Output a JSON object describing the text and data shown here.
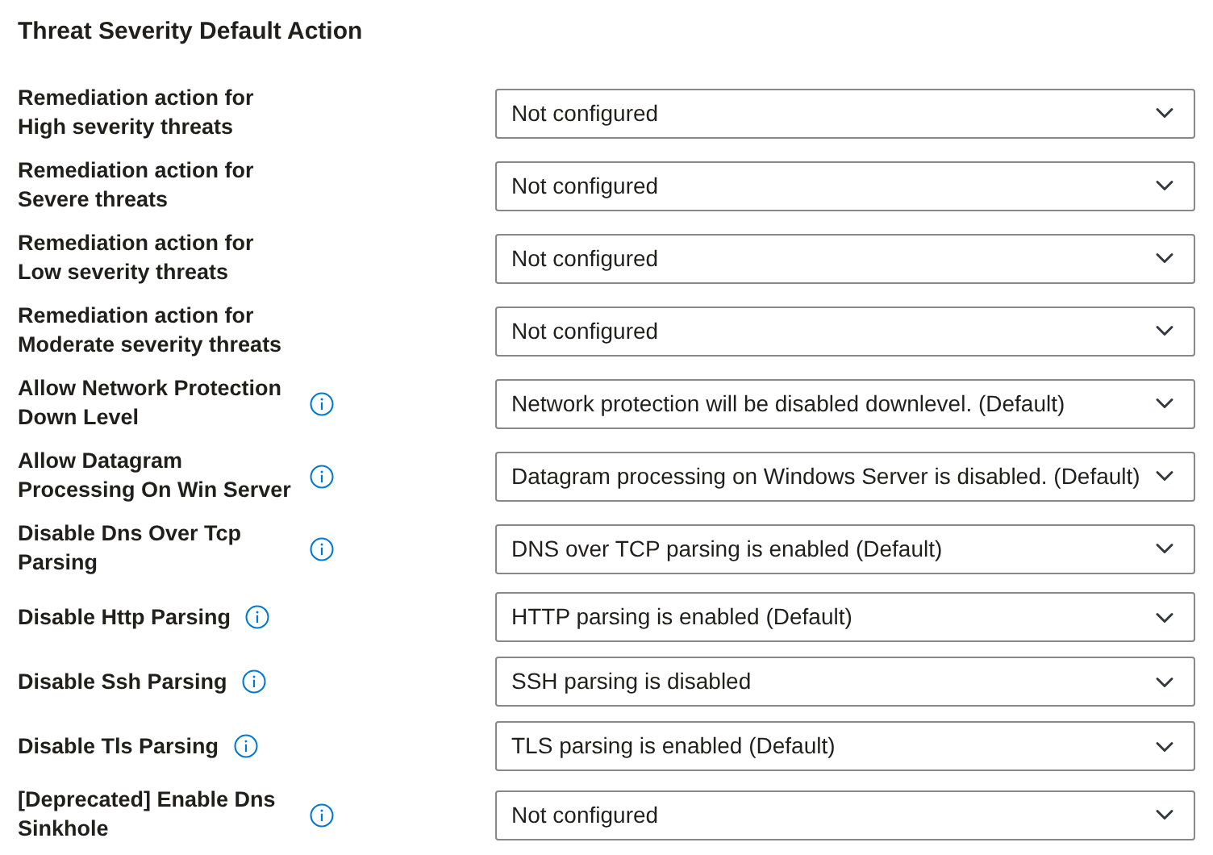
{
  "title": "Threat Severity Default Action",
  "settings": [
    {
      "label": "Remediation action for High severity threats",
      "info": false,
      "value": "Not configured"
    },
    {
      "label": "Remediation action for Severe threats",
      "info": false,
      "value": "Not configured"
    },
    {
      "label": "Remediation action for Low severity threats",
      "info": false,
      "value": "Not configured"
    },
    {
      "label": "Remediation action for Moderate severity threats",
      "info": false,
      "value": "Not configured"
    },
    {
      "label": "Allow Network Protection Down Level",
      "info": true,
      "value": "Network protection will be disabled downlevel. (Default)"
    },
    {
      "label": "Allow Datagram Processing On Win Server",
      "info": true,
      "value": "Datagram processing on Windows Server is disabled. (Default)"
    },
    {
      "label": "Disable Dns Over Tcp Parsing",
      "info": true,
      "value": "DNS over TCP parsing is enabled (Default)"
    },
    {
      "label": "Disable Http Parsing",
      "info": true,
      "value": "HTTP parsing is enabled (Default)"
    },
    {
      "label": "Disable Ssh Parsing",
      "info": true,
      "value": "SSH parsing is disabled"
    },
    {
      "label": "Disable Tls Parsing",
      "info": true,
      "value": "TLS parsing is enabled (Default)"
    },
    {
      "label": "[Deprecated] Enable Dns Sinkhole",
      "info": true,
      "value": "Not configured"
    }
  ]
}
